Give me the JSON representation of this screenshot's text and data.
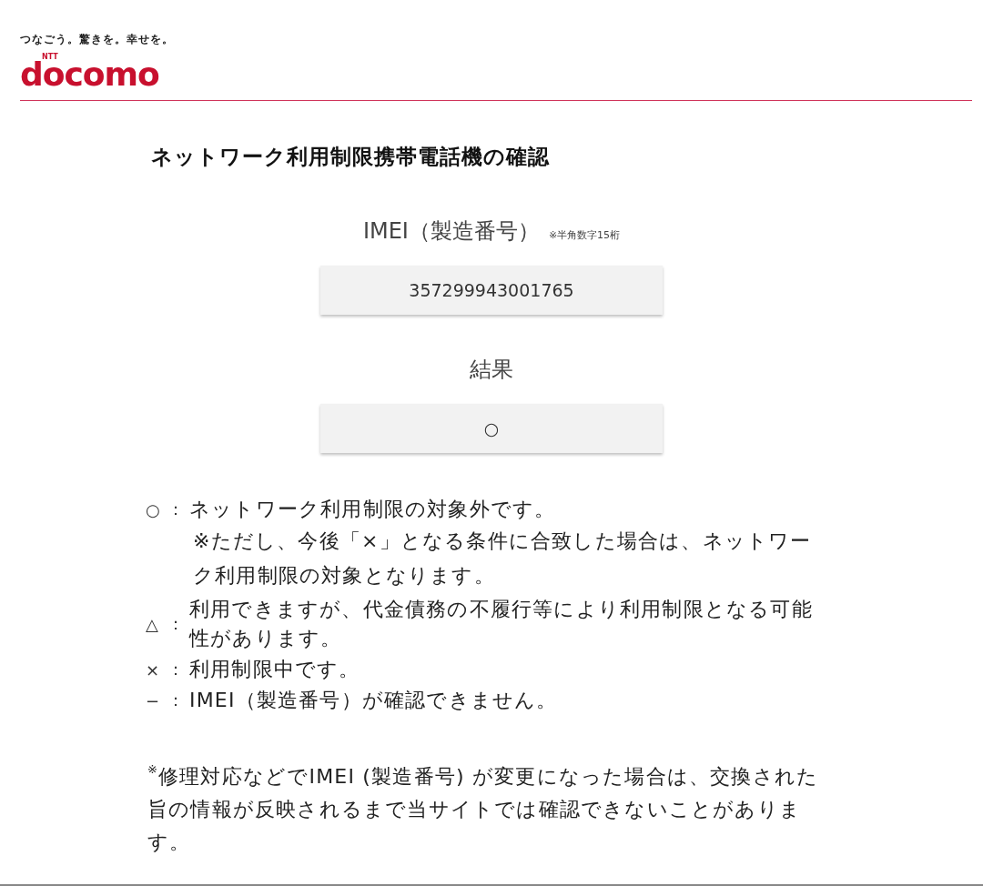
{
  "header": {
    "tagline": "つなごう。驚きを。幸せを。",
    "logo_small": "NTT",
    "logo": "docomo"
  },
  "title": "ネットワーク利用制限携帯電話機の確認",
  "imei": {
    "label": "IMEI（製造番号）",
    "hint": "※半角数字15桁",
    "value": "357299943001765"
  },
  "result": {
    "label": "結果",
    "value": "○"
  },
  "legend": [
    {
      "symbol": "○",
      "colon": "：",
      "text": "ネットワーク利用制限の対象外です。",
      "note": "※ただし、今後「×」となる条件に合致した場合は、ネットワーク利用制限の対象となります。"
    },
    {
      "symbol": "△",
      "colon": "：",
      "text": "利用できますが、代金債務の不履行等により利用制限となる可能性があります。"
    },
    {
      "symbol": "×",
      "colon": "：",
      "text": "利用制限中です。"
    },
    {
      "symbol": "−",
      "colon": "：",
      "text": "IMEI（製造番号）が確認できません。"
    }
  ],
  "footnote": "$^{※}$修理対応などでIMEI (製造番号) が変更になった場合は、交換された旨の情報が反映されるまで当サイトでは確認できないことがあります。"
}
